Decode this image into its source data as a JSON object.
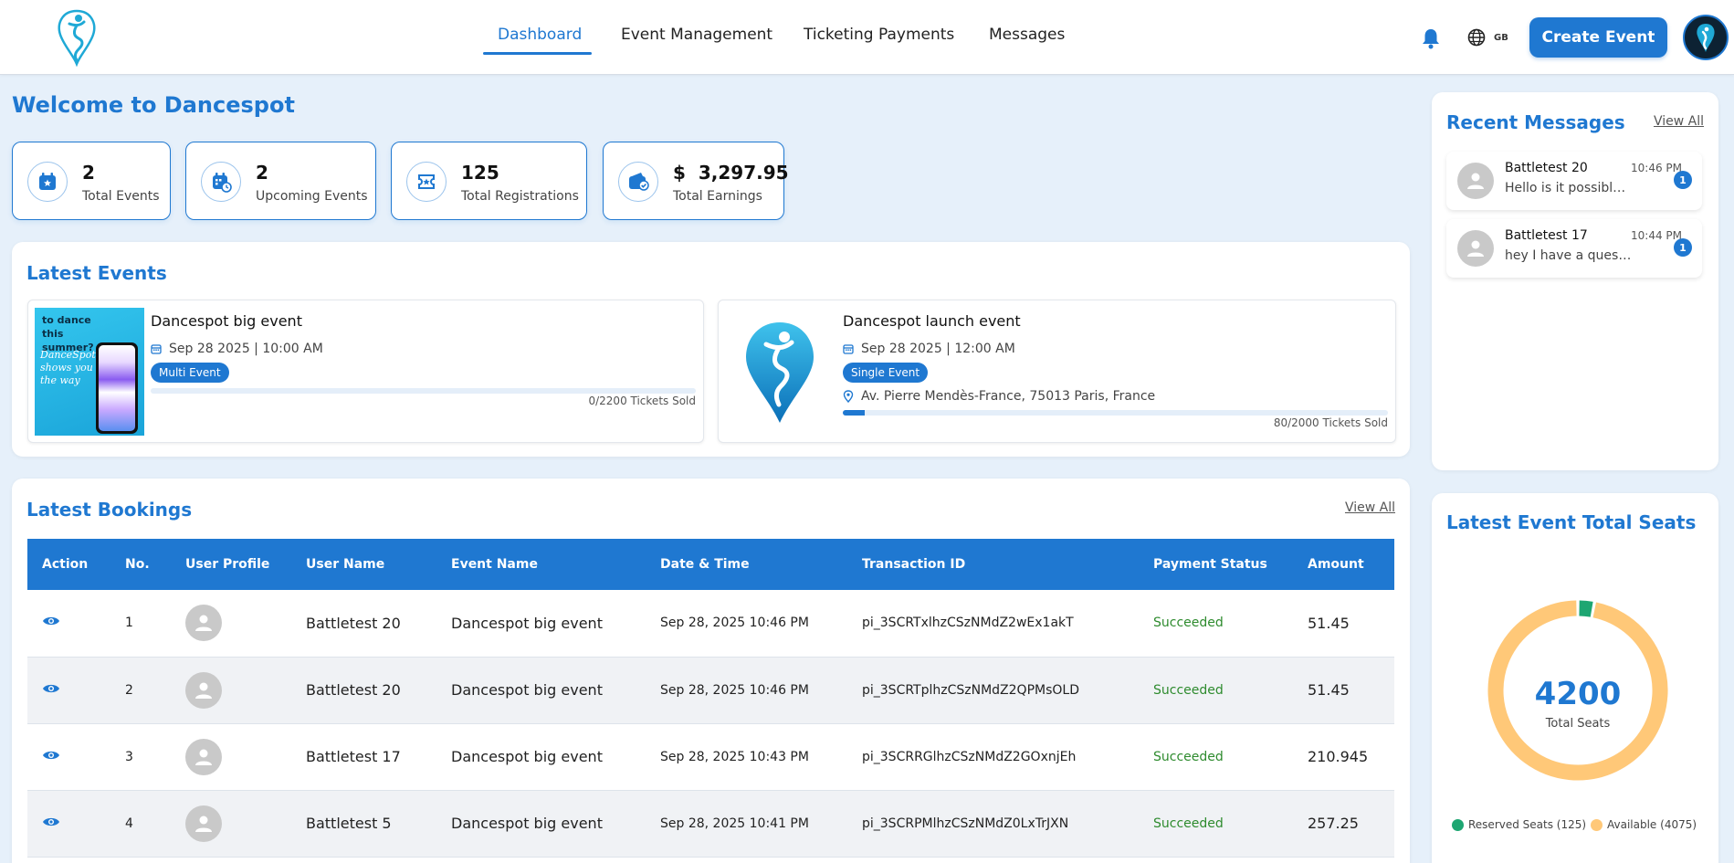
{
  "nav": {
    "items": [
      {
        "label": "Dashboard",
        "active": true
      },
      {
        "label": "Event Management",
        "active": false
      },
      {
        "label": "Ticketing Payments",
        "active": false
      },
      {
        "label": "Messages",
        "active": false
      }
    ],
    "lang": "GB",
    "create_label": "Create Event",
    "icons": {
      "notifications": "bell-icon",
      "language": "globe-icon"
    }
  },
  "welcome": "Welcome to Dancespot",
  "stats": [
    {
      "value": "2",
      "label": "Total Events",
      "icon": "calendar-star-icon"
    },
    {
      "value": "2",
      "label": "Upcoming Events",
      "icon": "calendar-clock-icon"
    },
    {
      "value": "125",
      "label": "Total Registrations",
      "icon": "ticket-star-icon"
    },
    {
      "value": "3,297.95",
      "currency": "$",
      "label": "Total Earnings",
      "icon": "wallet-check-icon"
    }
  ],
  "latest_events": {
    "title": "Latest Events",
    "events": [
      {
        "title": "Dancespot big event",
        "date": "Sep 28 2025 | 10:00 AM",
        "badge": "Multi Event",
        "tickets": "0/2200 Tickets Sold",
        "sold_fraction": 0.0,
        "poster_text_1": "to dance this summer?",
        "poster_text_2": "DanceSpot shows you the way"
      },
      {
        "title": "Dancespot launch event",
        "date": "Sep 28 2025 | 12:00 AM",
        "badge": "Single Event",
        "address": "Av. Pierre Mendès-France, 75013 Paris, France",
        "tickets": "80/2000 Tickets Sold",
        "sold_fraction": 0.04
      }
    ]
  },
  "bookings": {
    "title": "Latest Bookings",
    "view_all": "View All",
    "columns": [
      "Action",
      "No.",
      "User Profile",
      "User Name",
      "Event Name",
      "Date & Time",
      "Transaction ID",
      "Payment Status",
      "Amount"
    ],
    "rows": [
      {
        "no": "1",
        "user": "Battletest 20",
        "event": "Dancespot big event",
        "datetime": "Sep 28, 2025 10:46 PM",
        "txn": "pi_3SCRTxlhzCSzNMdZ2wEx1akT",
        "status": "Succeeded",
        "amount": "51.45"
      },
      {
        "no": "2",
        "user": "Battletest 20",
        "event": "Dancespot big event",
        "datetime": "Sep 28, 2025 10:46 PM",
        "txn": "pi_3SCRTplhzCSzNMdZ2QPMsOLD",
        "status": "Succeeded",
        "amount": "51.45"
      },
      {
        "no": "3",
        "user": "Battletest 17",
        "event": "Dancespot big event",
        "datetime": "Sep 28, 2025 10:43 PM",
        "txn": "pi_3SCRRGlhzCSzNMdZ2GOxnjEh",
        "status": "Succeeded",
        "amount": "210.945"
      },
      {
        "no": "4",
        "user": "Battletest 5",
        "event": "Dancespot big event",
        "datetime": "Sep 28, 2025 10:41 PM",
        "txn": "pi_3SCRPMlhzCSzNMdZ0LxTrJXN",
        "status": "Succeeded",
        "amount": "257.25"
      }
    ]
  },
  "messages": {
    "title": "Recent Messages",
    "view_all": "View All",
    "items": [
      {
        "name": "Battletest 20",
        "time": "10:46 PM",
        "text": "Hello is it possible to book",
        "unread": "1"
      },
      {
        "name": "Battletest 17",
        "time": "10:44 PM",
        "text": "hey I have a question regarding",
        "unread": "1"
      }
    ]
  },
  "seats": {
    "title": "Latest Event Total Seats",
    "total": "4200",
    "total_label": "Total Seats",
    "reserved_label": "Reserved Seats (125)",
    "available_label": "Available (4075)",
    "reserved": 125,
    "available": 4075,
    "colors": {
      "reserved": "#1ea672",
      "available": "#ffc878"
    }
  },
  "colors": {
    "accent": "#1f78d1",
    "success": "#2e8b2e",
    "background": "#e6f0fa"
  }
}
